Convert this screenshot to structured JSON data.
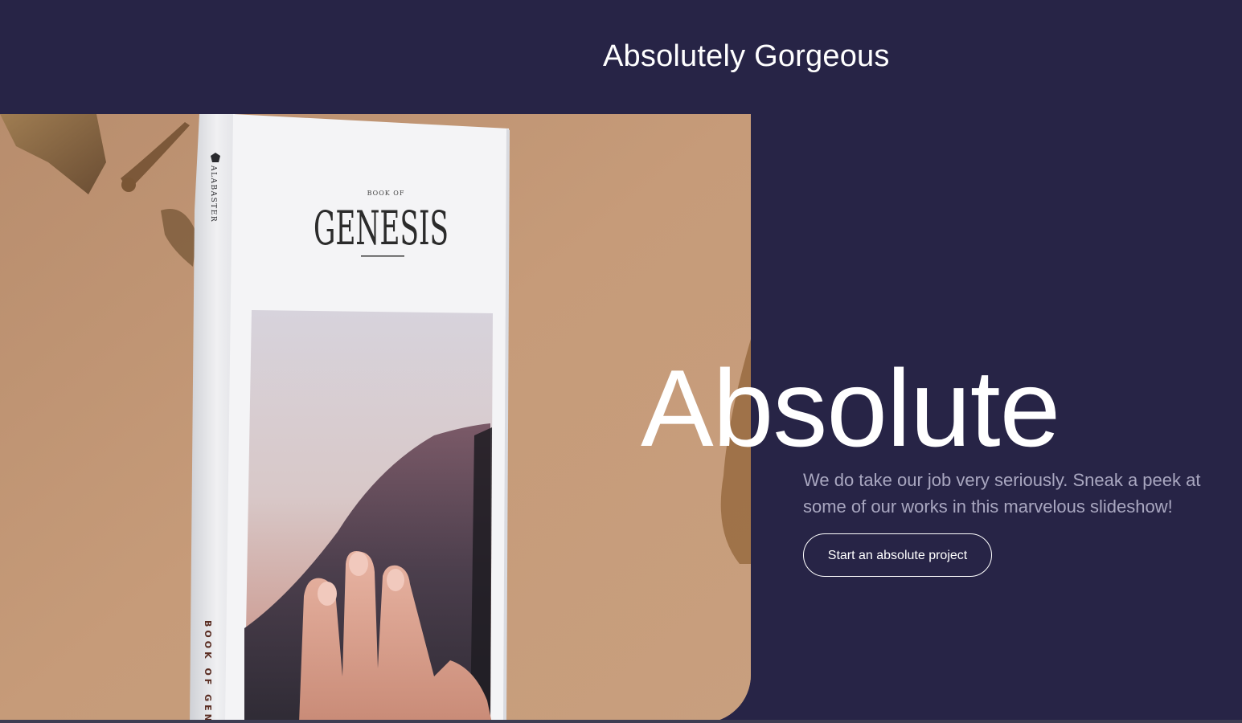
{
  "header": {
    "title": "Absolutely Gorgeous"
  },
  "hero": {
    "heading": "Absolute",
    "text": "We do take our job very seriously. Sneak a peek at some of our works in this marvelous slideshow!",
    "cta_label": "Start an absolute project",
    "image": {
      "spine_brand": "ALABASTER",
      "spine_title": "BOOK OF GENE",
      "cover_kicker": "BOOK OF",
      "cover_title": "GENESIS"
    }
  },
  "colors": {
    "background": "#272446",
    "text": "#ffffff",
    "muted_text": "#a9a7c0",
    "photo_backdrop": "#c49977"
  }
}
